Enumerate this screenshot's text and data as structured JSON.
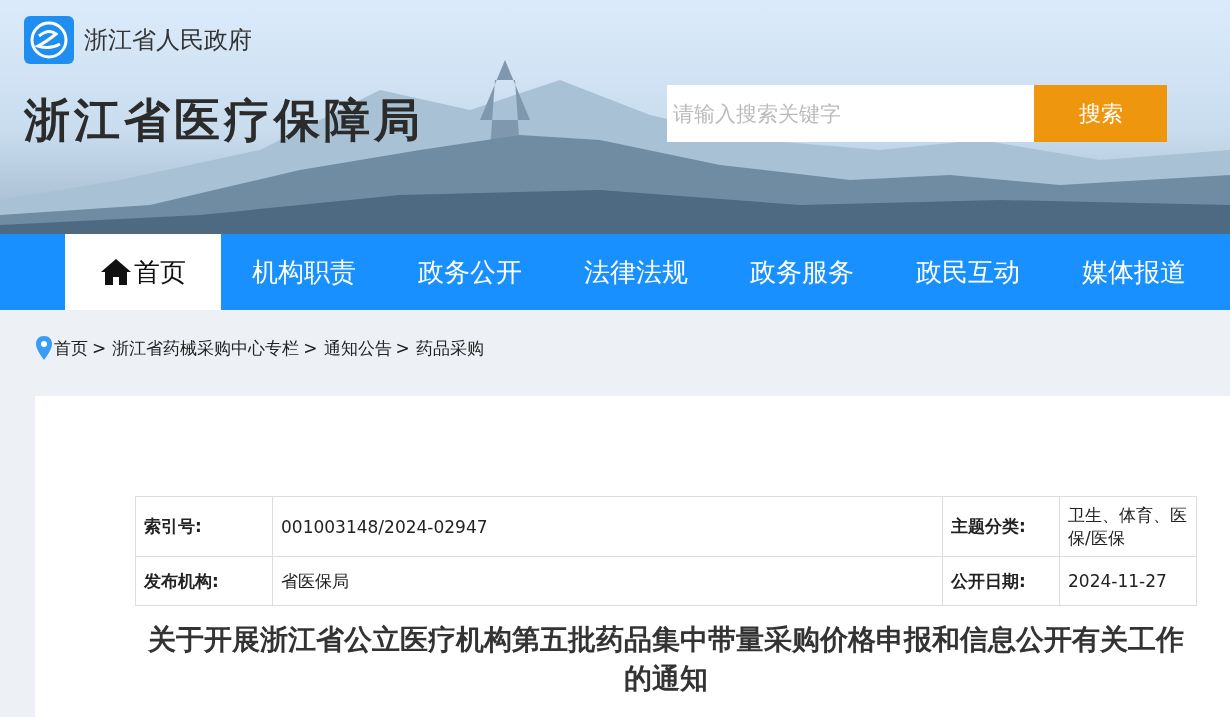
{
  "header": {
    "site_name": "浙江省人民政府",
    "bureau_title": "浙江省医疗保障局",
    "search": {
      "placeholder": "请输入搜索关键字",
      "button": "搜索"
    }
  },
  "nav": [
    {
      "label": "首页",
      "selected": true,
      "kind": "home"
    },
    {
      "label": "机构职责",
      "selected": false,
      "kind": "text"
    },
    {
      "label": "政务公开",
      "selected": false,
      "kind": "text"
    },
    {
      "label": "法律法规",
      "selected": false,
      "kind": "text"
    },
    {
      "label": "政务服务",
      "selected": false,
      "kind": "text"
    },
    {
      "label": "政民互动",
      "selected": false,
      "kind": "text"
    },
    {
      "label": "媒体报道",
      "selected": false,
      "kind": "text"
    }
  ],
  "breadcrumb": {
    "separator": ">",
    "items": [
      "首页",
      "浙江省药械采购中心专栏",
      "通知公告",
      "药品采购"
    ]
  },
  "info_table": {
    "rows": [
      {
        "label_1": "索引号:",
        "value_1": "001003148/2024-02947",
        "label_2": "主题分类:",
        "value_2": "卫生、体育、医保/医保"
      },
      {
        "label_1": "发布机构:",
        "value_1": "省医保局",
        "label_2": "公开日期:",
        "value_2": "2024-11-27"
      }
    ]
  },
  "article": {
    "title": "关于开展浙江省公立医疗机构第五批药品集中带量采购价格申报和信息公开有关工作的通知"
  }
}
